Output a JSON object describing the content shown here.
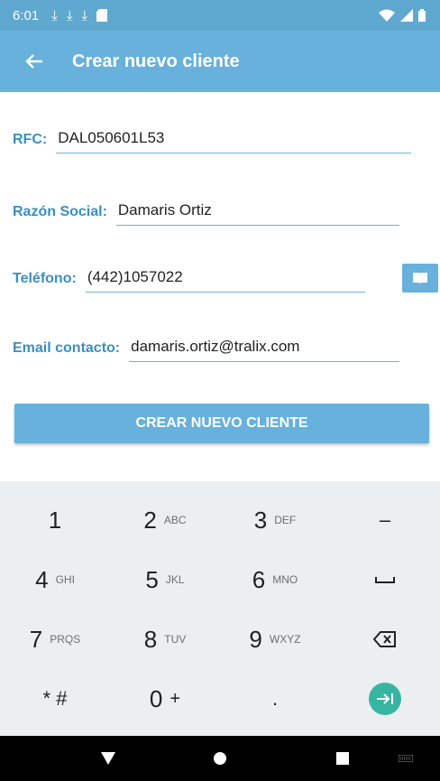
{
  "status_bar": {
    "time": "6:01"
  },
  "app_bar": {
    "title": "Crear nuevo cliente"
  },
  "form": {
    "rfc": {
      "label": "RFC:",
      "value": "DAL050601L53"
    },
    "razon_social": {
      "label": "Razón Social:",
      "value": "Damaris Ortiz"
    },
    "telefono": {
      "label": "Teléfono:",
      "value": "(442)1057022"
    },
    "email": {
      "label": "Email contacto:",
      "value": "damaris.ortiz@tralix.com"
    }
  },
  "create_button": {
    "label": "CREAR NUEVO CLIENTE"
  },
  "keyboard": {
    "rows": [
      [
        {
          "num": "1",
          "letters": ""
        },
        {
          "num": "2",
          "letters": "ABC"
        },
        {
          "num": "3",
          "letters": "DEF"
        },
        {
          "sym": "–"
        }
      ],
      [
        {
          "num": "4",
          "letters": "GHI"
        },
        {
          "num": "5",
          "letters": "JKL"
        },
        {
          "num": "6",
          "letters": "MNO"
        },
        {
          "sym": "space"
        }
      ],
      [
        {
          "num": "7",
          "letters": "PRQS"
        },
        {
          "num": "8",
          "letters": "TUV"
        },
        {
          "num": "9",
          "letters": "WXYZ"
        },
        {
          "sym": "backspace"
        }
      ],
      [
        {
          "num": "* #",
          "letters": ""
        },
        {
          "num": "0",
          "letters": "+"
        },
        {
          "sym": "."
        },
        {
          "sym": "go"
        }
      ]
    ]
  },
  "colors": {
    "status_bar": "#5fa8cf",
    "app_bar": "#67b1dc",
    "label": "#3a8fc0",
    "go_button": "#36b5a2"
  }
}
